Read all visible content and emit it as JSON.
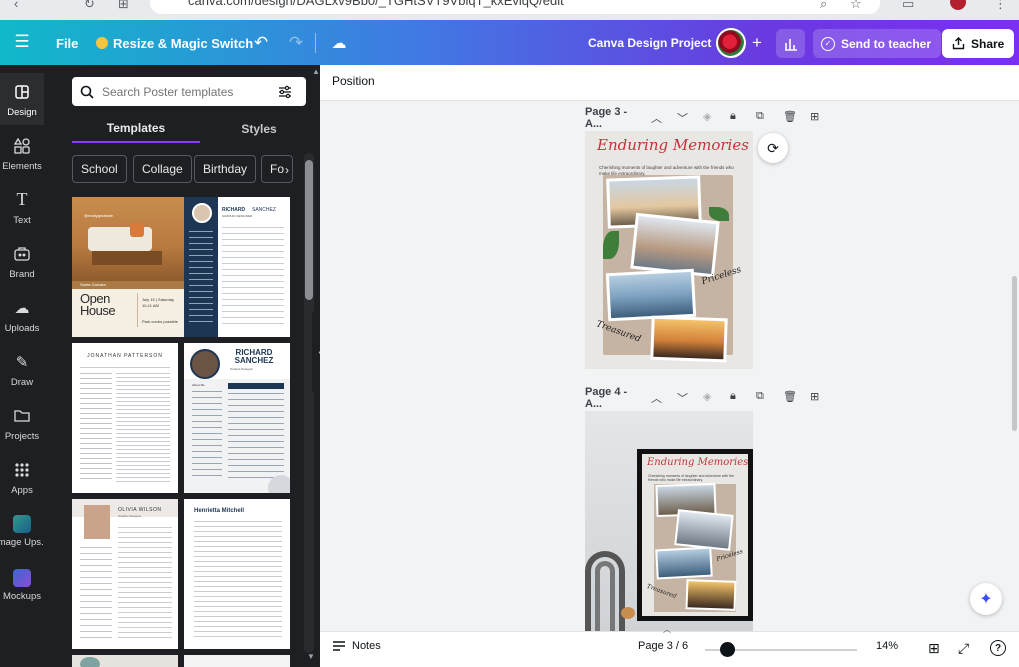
{
  "browser": {
    "url": "canva.com/design/DAGLxv9Bb0/_TGHtSVT9VbiqT_kxEviqQ/edit"
  },
  "header": {
    "file_label": "File",
    "resize_label": "Resize & Magic Switch",
    "project_title": "Canva Design Project",
    "send_label": "Send to teacher",
    "share_label": "Share"
  },
  "rail": {
    "items": [
      {
        "label": "Design"
      },
      {
        "label": "Elements"
      },
      {
        "label": "Text"
      },
      {
        "label": "Brand"
      },
      {
        "label": "Uploads"
      },
      {
        "label": "Draw"
      },
      {
        "label": "Projects"
      },
      {
        "label": "Apps"
      },
      {
        "label": "Image Ups..."
      },
      {
        "label": "Mockups"
      }
    ]
  },
  "panel": {
    "search_placeholder": "Search Poster templates",
    "tabs": [
      {
        "label": "Templates"
      },
      {
        "label": "Styles"
      }
    ],
    "chips": [
      {
        "label": "School"
      },
      {
        "label": "Collage"
      },
      {
        "label": "Birthday"
      },
      {
        "label": "Fo"
      }
    ],
    "templates": [
      {
        "top_text": "@reallygreatsite",
        "title": "Open House",
        "date": "July 15 | Saturday",
        "time": "10-11 AM",
        "footer": "Park conbo possible",
        "label": "Santa Gulcara"
      },
      {
        "name_first": "RICHARD",
        "name_last": "SANCHEZ",
        "role": "GRAPHIC DESIGNER"
      },
      {
        "name": "JONATHAN PATTERSON"
      },
      {
        "name": "RICHARD SANCHEZ",
        "role": "Product Designer",
        "sub": "About Me"
      },
      {
        "name": "OLIVIA WILSON",
        "role": "Graphic Designer"
      },
      {
        "name": "Henrietta Mitchell"
      }
    ]
  },
  "toolbar": {
    "position_label": "Position"
  },
  "canvas": {
    "pages": [
      {
        "title": "Page 3 - A...",
        "poster_title": "Enduring Memories",
        "poster_sub": "Cherishing moments of laughter and adventure with the friends who make life extraordinary.",
        "tag1": "Priceless",
        "tag2": "Treasured"
      },
      {
        "title": "Page 4 - A...",
        "poster_title": "Enduring Memories",
        "poster_sub": "Cherishing moments of laughter and adventure with the friends who make life extraordinary.",
        "tag1": "Priceless",
        "tag2": "Treasured"
      }
    ]
  },
  "footer": {
    "notes_label": "Notes",
    "page_indicator": "Page 3 / 6",
    "zoom": "14%",
    "help": "?"
  }
}
